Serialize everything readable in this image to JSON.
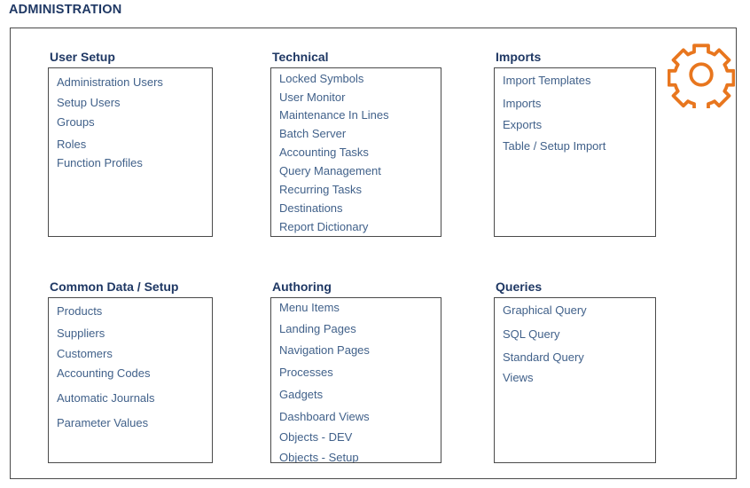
{
  "header": {
    "title": "ADMINISTRATION"
  },
  "icons": {
    "gear": {
      "name": "gear-icon",
      "color": "#E8761E"
    }
  },
  "colors": {
    "title": "#1f3864",
    "section_title": "#1f3864",
    "item_text": "#41618a",
    "border": "#4a4a4a",
    "accent": "#E8761E",
    "background": "#ffffff"
  },
  "sections": [
    {
      "id": "user-setup",
      "title": "User Setup",
      "items": [
        "Administration Users",
        "Setup Users",
        "Groups",
        "Roles",
        "Function Profiles"
      ],
      "item_offsets": [
        8,
        31,
        53,
        78,
        99
      ]
    },
    {
      "id": "technical",
      "title": "Technical",
      "items": [
        "Locked Symbols",
        "User Monitor",
        "Maintenance In Lines",
        "Batch Server",
        "Accounting Tasks",
        "Query Management",
        "Recurring Tasks",
        "Destinations",
        "Report Dictionary"
      ],
      "item_offsets": [
        4,
        25,
        45,
        66,
        87,
        108,
        129,
        150,
        171
      ]
    },
    {
      "id": "imports",
      "title": "Imports",
      "items": [
        "Import Templates",
        "Imports",
        "Exports",
        "Table / Setup Import"
      ],
      "item_offsets": [
        6,
        32,
        56,
        80
      ]
    },
    {
      "id": "common-data-setup",
      "title": "Common Data / Setup",
      "items": [
        "Products",
        "Suppliers",
        "Customers",
        "Accounting Codes",
        "Automatic Journals",
        "Parameter Values"
      ],
      "item_offsets": [
        7,
        32,
        55,
        77,
        105,
        133
      ]
    },
    {
      "id": "authoring",
      "title": "Authoring",
      "items": [
        "Menu Items",
        "Landing Pages",
        "Navigation Pages",
        "Processes",
        "Gadgets",
        "Dashboard Views",
        "Objects - DEV",
        "Objects - Setup"
      ],
      "item_offsets": [
        3,
        27,
        51,
        76,
        101,
        126,
        149,
        172
      ]
    },
    {
      "id": "queries",
      "title": "Queries",
      "items": [
        "Graphical Query",
        "SQL Query",
        "Standard Query",
        "Views"
      ],
      "item_offsets": [
        6,
        33,
        59,
        82
      ]
    }
  ]
}
